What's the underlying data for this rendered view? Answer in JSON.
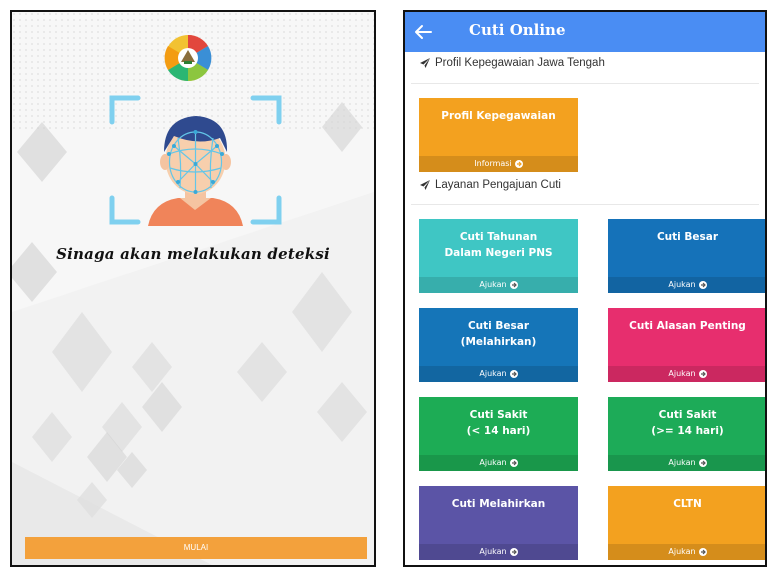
{
  "left": {
    "detect_text": "Sinaga akan melakukan deteksi",
    "start_label": "MULAI",
    "logo_icon": "government-seal-icon",
    "face_icon": "face-scan-icon"
  },
  "right": {
    "app_title": "Cuti Online",
    "back_icon": "arrow-left-icon",
    "section_profile": "Profil Kepegawaian Jawa Tengah",
    "section_services": "Layanan Pengajuan Cuti",
    "profile_card": {
      "title": "Profil Kepegawaian",
      "footer": "Informasi",
      "color": "#f3a11f"
    },
    "cards": [
      {
        "title": "Cuti Tahunan\nDalam Negeri PNS",
        "footer": "Ajukan",
        "color": "#3fc6c4"
      },
      {
        "title": "Cuti Besar",
        "footer": "Ajukan",
        "color": "#1572b9"
      },
      {
        "title": "Cuti Besar\n(Melahirkan)",
        "footer": "Ajukan",
        "color": "#1575b8"
      },
      {
        "title": "Cuti Alasan Penting",
        "footer": "Ajukan",
        "color": "#e72e6e"
      },
      {
        "title": "Cuti Sakit\n(< 14 hari)",
        "footer": "Ajukan",
        "color": "#1dac55"
      },
      {
        "title": "Cuti Sakit\n(>= 14 hari)",
        "footer": "Ajukan",
        "color": "#1dab58"
      },
      {
        "title": "Cuti Melahirkan",
        "footer": "Ajukan",
        "color": "#5b54a6"
      },
      {
        "title": "CLTN",
        "footer": "Ajukan",
        "color": "#f3a11f"
      }
    ]
  }
}
